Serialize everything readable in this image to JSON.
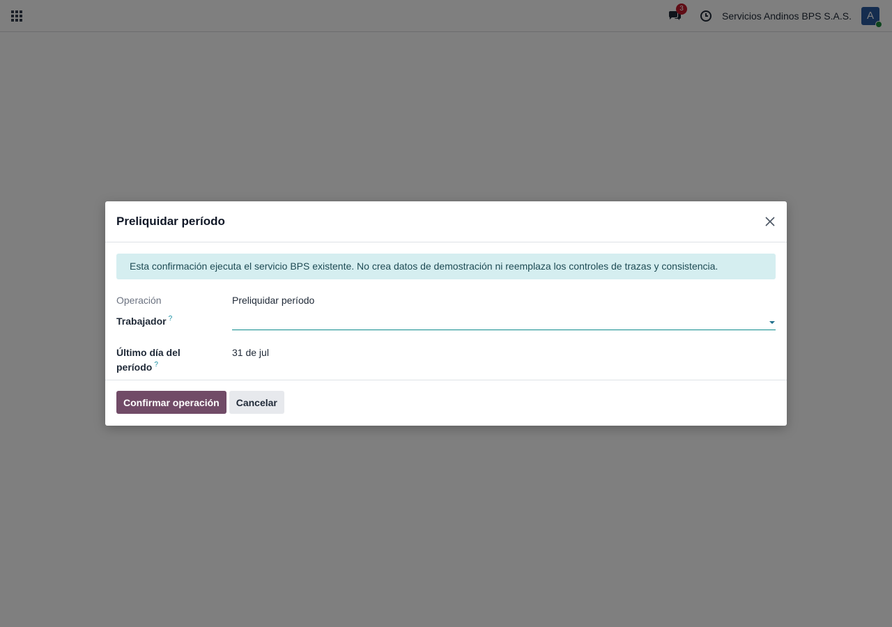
{
  "navbar": {
    "apps_icon": "apps-grid-icon",
    "chat_icon": "chat-bubbles-icon",
    "chat_badge": "3",
    "clock_icon": "clock-icon",
    "company_name": "Servicios Andinos BPS S.A.S.",
    "avatar_initial": "A",
    "accent_badge_color": "#c11b2c",
    "avatar_color": "#2a5a9f",
    "status_dot_color": "#1d8b3d"
  },
  "dialog": {
    "title": "Preliquidar período",
    "close_icon": "close-icon",
    "alert_text": "Esta confirmación ejecuta el servicio BPS existente. No crea datos de demostración ni reemplaza los controles de trazas y consistencia.",
    "fields": {
      "operation_label": "Operación",
      "operation_value": "Preliquidar período",
      "worker_label": "Trabajador",
      "worker_help": "?",
      "worker_value": "",
      "date_label_line1": "Último día del",
      "date_label_line2": "período",
      "date_help": "?",
      "date_value": "31 de jul"
    },
    "buttons": {
      "confirm": "Confirmar operación",
      "cancel": "Cancelar"
    },
    "primary_color": "#714b67",
    "alert_color": "#d5eef0"
  }
}
